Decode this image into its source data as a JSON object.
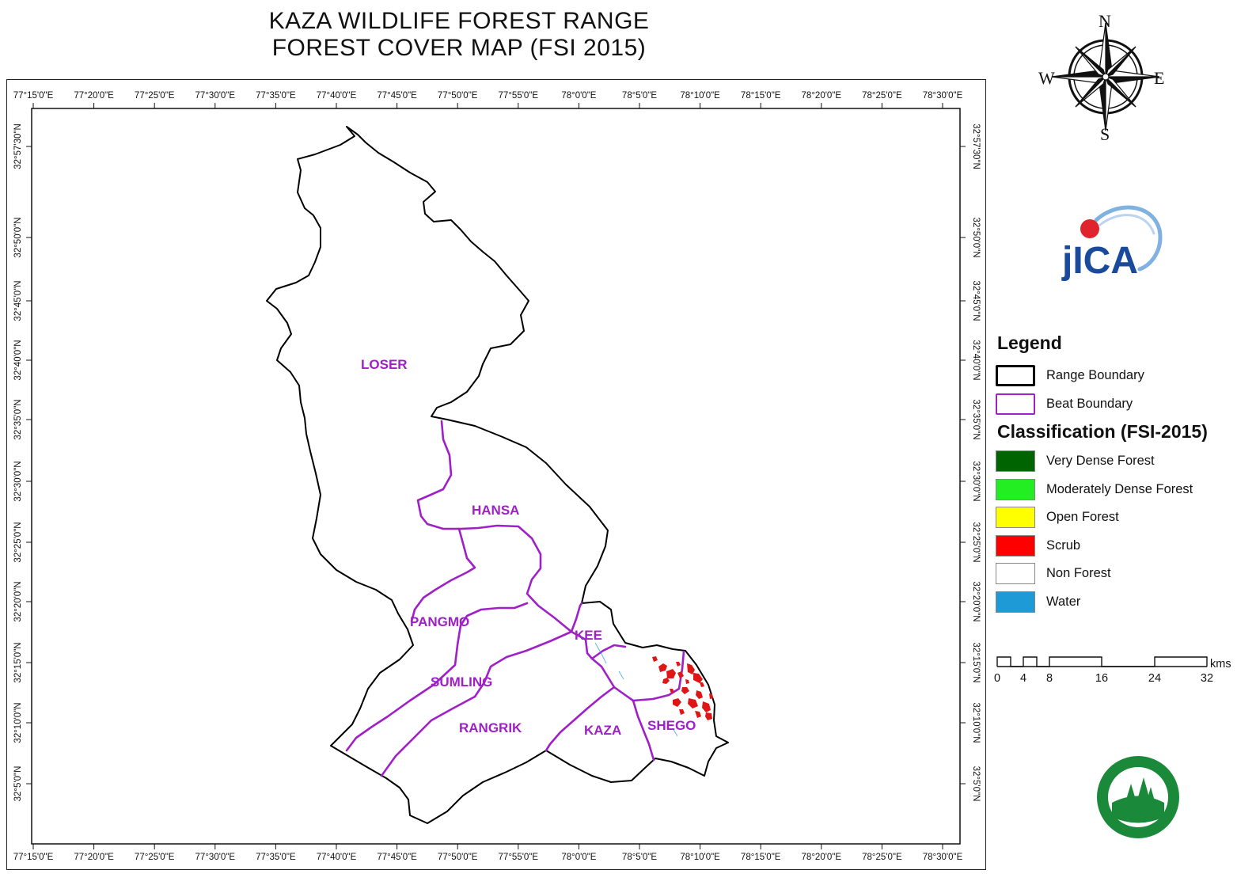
{
  "title": {
    "line1": "KAZA WILDLIFE FOREST RANGE",
    "line2": "FOREST COVER MAP (FSI 2015)"
  },
  "longitude_labels": [
    "77°15'0\"E",
    "77°20'0\"E",
    "77°25'0\"E",
    "77°30'0\"E",
    "77°35'0\"E",
    "77°40'0\"E",
    "77°45'0\"E",
    "77°50'0\"E",
    "77°55'0\"E",
    "78°0'0\"E",
    "78°5'0\"E",
    "78°10'0\"E",
    "78°15'0\"E",
    "78°20'0\"E",
    "78°25'0\"E",
    "78°30'0\"E"
  ],
  "latitude_labels": [
    "32°57'30\"N",
    "32°50'0\"N",
    "32°45'0\"N",
    "32°40'0\"N",
    "32°35'0\"N",
    "32°30'0\"N",
    "32°25'0\"N",
    "32°20'0\"N",
    "32°15'0\"N",
    "32°10'0\"N",
    "32°5'0\"N"
  ],
  "beats": [
    "LOSER",
    "HANSA",
    "PANGMO",
    "KEE",
    "SUMLING",
    "RANGRIK",
    "KAZA",
    "SHEGO"
  ],
  "compass": {
    "n": "N",
    "s": "S",
    "e": "E",
    "w": "W"
  },
  "logo_text": "jICA",
  "legend": {
    "title": "Legend",
    "boundaries": [
      {
        "label": "Range Boundary",
        "color": "#000000"
      },
      {
        "label": "Beat Boundary",
        "color": "#a020c8"
      }
    ],
    "classification_title": "Classification (FSI-2015)",
    "classes": [
      {
        "label": "Very Dense Forest",
        "color": "#006400"
      },
      {
        "label": "Moderately Dense Forest",
        "color": "#22ee22"
      },
      {
        "label": "Open Forest",
        "color": "#ffff00"
      },
      {
        "label": "Scrub",
        "color": "#ff0000"
      },
      {
        "label": "Non Forest",
        "color": "#ffffff"
      },
      {
        "label": "Water",
        "color": "#1e9ad6"
      }
    ]
  },
  "scale": {
    "ticks": [
      "0",
      "4",
      "8",
      "16",
      "24",
      "32"
    ],
    "unit": "kms"
  }
}
